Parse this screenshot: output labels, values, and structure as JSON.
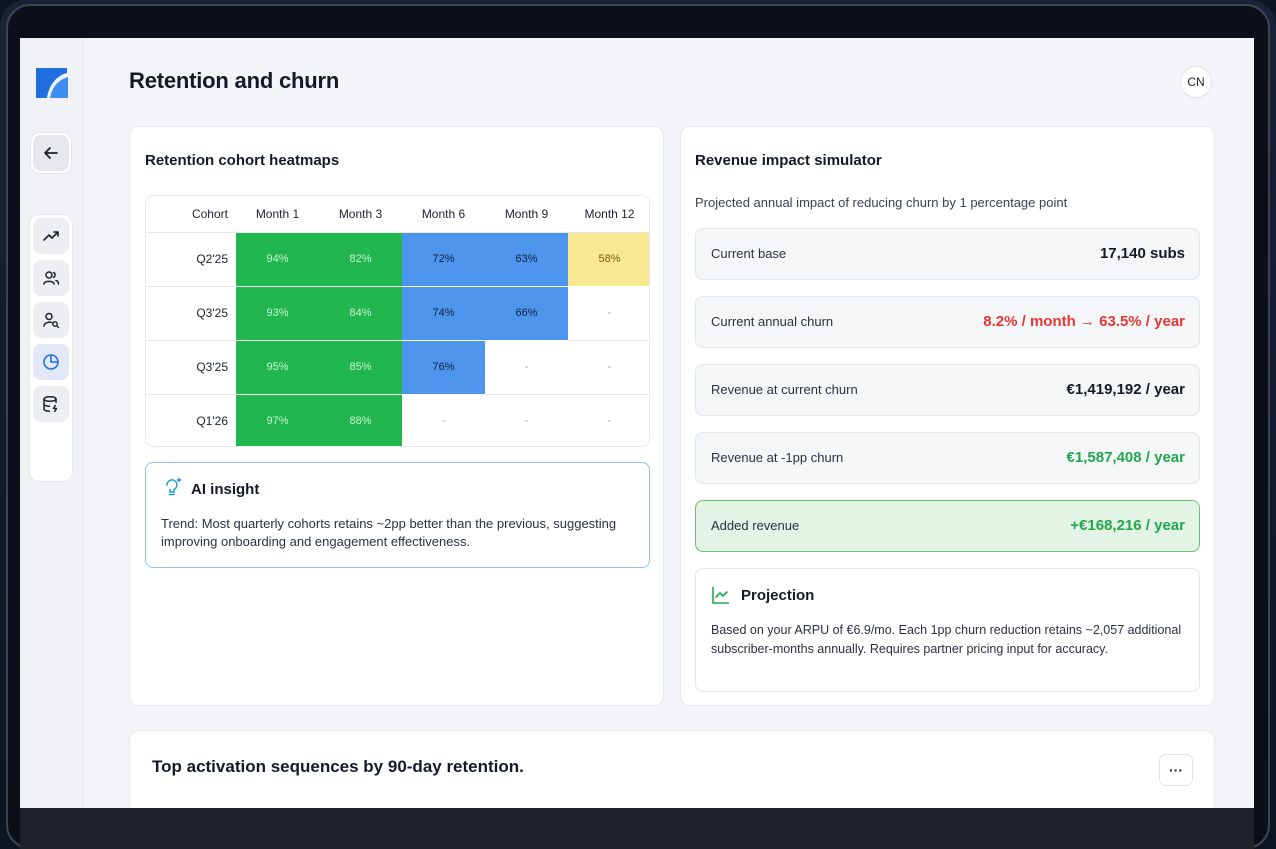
{
  "page": {
    "title": "Retention and churn",
    "avatar_initials": "CN"
  },
  "sidebar": {
    "items": [
      {
        "name": "trend-icon"
      },
      {
        "name": "users-icon"
      },
      {
        "name": "user-search-icon"
      },
      {
        "name": "pie-chart-icon",
        "active": true
      },
      {
        "name": "database-icon"
      }
    ]
  },
  "heatmap": {
    "title": "Retention cohort heatmaps",
    "columns": [
      "Cohort",
      "Month 1",
      "Month 3",
      "Month 6",
      "Month 9",
      "Month 12"
    ],
    "rows": [
      {
        "cohort": "Q2'25",
        "cells": [
          "94%",
          "82%",
          "72%",
          "63%",
          "58%"
        ],
        "colors": [
          "green",
          "green",
          "blue",
          "blue",
          "yellow"
        ]
      },
      {
        "cohort": "Q3'25",
        "cells": [
          "93%",
          "84%",
          "74%",
          "66%",
          "-"
        ],
        "colors": [
          "green",
          "green",
          "blue",
          "blue",
          "empty"
        ]
      },
      {
        "cohort": "Q3'25",
        "cells": [
          "95%",
          "85%",
          "76%",
          "-",
          "-"
        ],
        "colors": [
          "green",
          "green",
          "blue",
          "empty",
          "empty"
        ]
      },
      {
        "cohort": "Q1'26",
        "cells": [
          "97%",
          "88%",
          "-",
          "-",
          "-"
        ],
        "colors": [
          "green",
          "green",
          "empty",
          "empty",
          "empty"
        ]
      }
    ]
  },
  "insight": {
    "title": "AI insight",
    "text": "Trend: Most quarterly cohorts retains ~2pp better than the previous, suggesting improving onboarding and engagement effectiveness."
  },
  "simulator": {
    "title": "Revenue impact simulator",
    "subtitle": "Projected annual impact of reducing churn by 1 percentage point",
    "rows": [
      {
        "label": "Current base",
        "value": "17,140 subs"
      },
      {
        "label": "Current annual churn",
        "value": "8.2% / month → 63.5% / year"
      },
      {
        "label": "Revenue at current churn",
        "value": "€1,419,192 / year"
      },
      {
        "label": "Revenue at -1pp churn",
        "value": "€1,587,408 / year"
      },
      {
        "label": "Added revenue",
        "value": "+€168,216 / year"
      }
    ],
    "projection_title": "Projection",
    "projection_text": "Based on your ARPU of €6.9/mo. Each 1pp churn reduction retains ~2,057 additional subscriber-months annually. Requires partner pricing input for accuracy."
  },
  "bottom": {
    "title": "Top activation sequences by 90-day retention.",
    "more_label": "···"
  },
  "colors": {
    "green": "#22b64e",
    "blue": "#4d94ec",
    "yellow": "#f8e891",
    "red_text": "#e53935",
    "green_text": "#22a74a",
    "brand": "#1f6fe0"
  }
}
